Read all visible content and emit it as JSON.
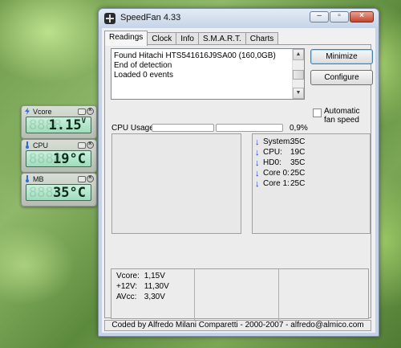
{
  "gadgets": [
    {
      "label": "Vcore",
      "value": "1.15",
      "unit": "V",
      "icon": "lightning-icon"
    },
    {
      "label": "CPU",
      "value": "19",
      "unit": "°C",
      "icon": "thermometer-icon"
    },
    {
      "label": "MB",
      "value": "35",
      "unit": "°C",
      "icon": "thermometer-icon"
    }
  ],
  "window": {
    "title": "SpeedFan 4.33",
    "controls": {
      "minimize": "–",
      "maximize": "▫",
      "close": "×"
    }
  },
  "tabs": [
    "Readings",
    "Clock",
    "Info",
    "S.M.A.R.T.",
    "Charts"
  ],
  "log": [
    "Found Hitachi HTS541616J9SA00 (160,0GB)",
    "End of detection",
    "Loaded 0 events"
  ],
  "buttons": {
    "minimize": "Minimize",
    "configure": "Configure"
  },
  "auto_fan": {
    "label": "Automatic fan speed",
    "checked": false
  },
  "cpu_usage": {
    "label": "CPU Usage",
    "percent": "0,9%"
  },
  "temperatures": [
    {
      "label": "System:",
      "value": "35C"
    },
    {
      "label": "CPU:",
      "value": "19C"
    },
    {
      "label": "HD0:",
      "value": "35C"
    },
    {
      "label": "Core 0:",
      "value": "25C"
    },
    {
      "label": "Core 1:",
      "value": "25C"
    }
  ],
  "voltages": [
    {
      "label": "Vcore:",
      "value": "1,15V"
    },
    {
      "label": "+12V:",
      "value": "11,30V"
    },
    {
      "label": "AVcc:",
      "value": "3,30V"
    }
  ],
  "status_bar": "Coded by Alfredo Milani Comparetti - 2000-2007 - alfredo@almico.com"
}
